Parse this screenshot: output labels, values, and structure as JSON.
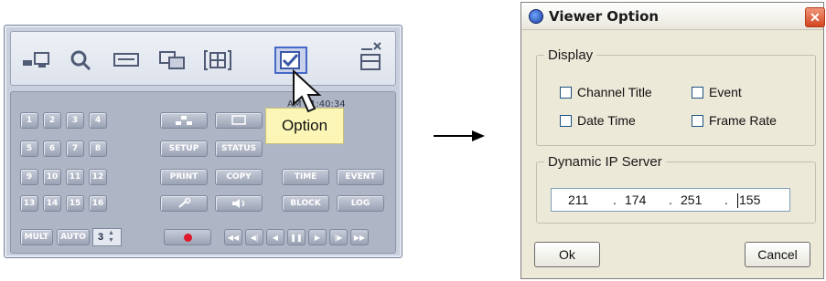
{
  "toolbar": {
    "icons": [
      "network-icon",
      "search-icon",
      "monitor-icon",
      "capture-icon",
      "split-screen-icon",
      "option-icon",
      "window-controls-icon"
    ],
    "active": "option-icon"
  },
  "grid": {
    "clock": "AM 11:40:34",
    "channels": [
      "1",
      "2",
      "3",
      "4",
      "5",
      "6",
      "7",
      "8",
      "9",
      "10",
      "11",
      "12",
      "13",
      "14",
      "15",
      "16"
    ],
    "functions": {
      "setup": "SETUP",
      "status": "STATUS",
      "print": "PRINT",
      "copy": "COPY",
      "time": "TIME",
      "event": "EVENT",
      "block": "BLOCK",
      "log": "LOG"
    },
    "mult": "MULT",
    "auto": "AUTO",
    "spin_value": "3"
  },
  "tooltip": "Option",
  "dialog": {
    "title": "Viewer Option",
    "display_group": "Display",
    "checkboxes": {
      "channel_title": "Channel Title",
      "event": "Event",
      "date_time": "Date Time",
      "frame_rate": "Frame Rate"
    },
    "dynamic_group": "Dynamic IP Server",
    "ip": {
      "o1": "211",
      "o2": "174",
      "o3": "251",
      "o4": "155",
      "dot": "."
    },
    "ok": "Ok",
    "cancel": "Cancel"
  },
  "colors": {
    "accent": "#4668c8",
    "tooltip_bg": "#fbf6b6",
    "close_red": "#d2451e"
  }
}
